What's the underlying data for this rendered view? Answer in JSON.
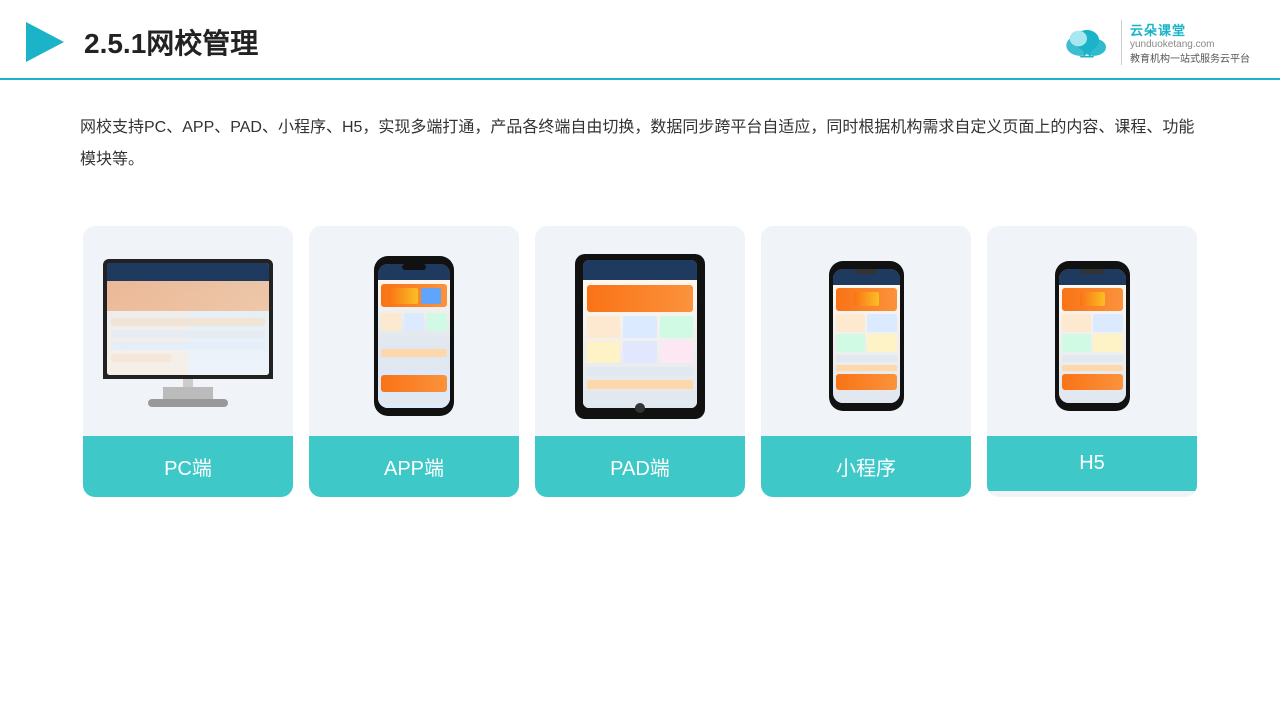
{
  "header": {
    "title": "2.5.1网校管理",
    "logo_main": "云朵课堂",
    "logo_url": "yunduoketang.com",
    "logo_slogan": "教育机构一站\n式服务云平台"
  },
  "description": "网校支持PC、APP、PAD、小程序、H5，实现多端打通，产品各终端自由切换，数据同步跨平台自适应，同时根据机构需求自定义页面上的内容、课程、功能模块等。",
  "cards": [
    {
      "label": "PC端",
      "type": "pc"
    },
    {
      "label": "APP端",
      "type": "phone"
    },
    {
      "label": "PAD端",
      "type": "tablet"
    },
    {
      "label": "小程序",
      "type": "mini-phone"
    },
    {
      "label": "H5",
      "type": "mini-phone"
    }
  ]
}
